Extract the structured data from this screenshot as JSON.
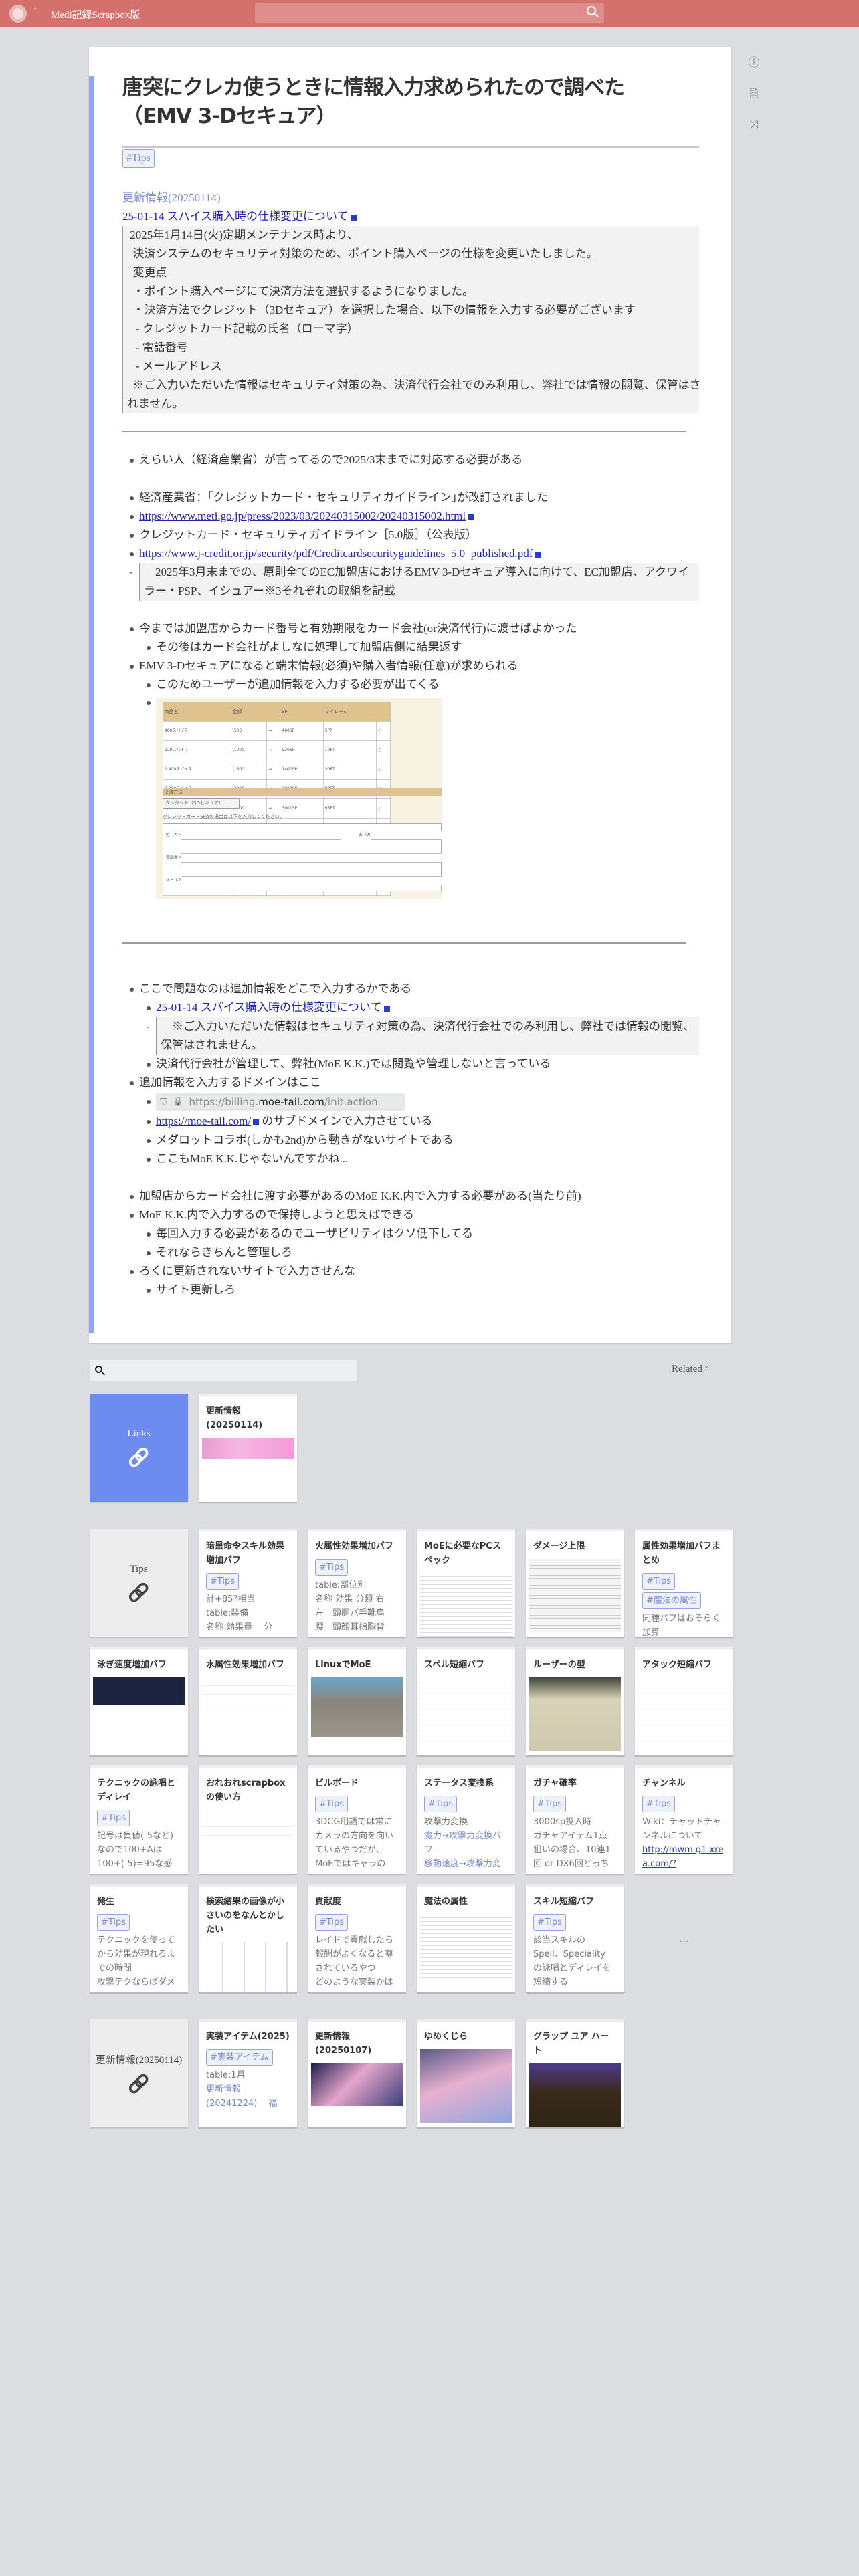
{
  "header": {
    "project": "Medi記録Scrapbox版",
    "search_placeholder": "",
    "logo_icon": "scrapbox-logo-icon"
  },
  "side_icons": [
    "info-icon",
    "page-icon",
    "shuffle-icon"
  ],
  "page": {
    "title": [
      "唐突にクレカ使うときに情報入力求められたので調べた",
      "（EMV 3-Dセキュア）"
    ],
    "tag": "#Tips",
    "update_title": "更新情報(20250114)",
    "update_link": "25-01-14 スパイス購入時の仕様変更について",
    "notice": [
      " 2025年1月14日(火)定期メンテナンス時より、",
      "  決済システムのセキュリティ対策のため、ポイント購入ページの仕様を変更いたしました。",
      "  変更点",
      "  ・ポイント購入ページにて決済方法を選択するようになりました。",
      "  ・決済方法でクレジット（3Dセキュア）を選択した場合、以下の情報を入力する必要がございます",
      "   - クレジットカード記載の氏名（ローマ字）",
      "   - 電話番号",
      "   - メールアドレス",
      "  ※ご入力いただいた情報はセキュリティ対策の為、決済代行会社でのみ利用し、弊社では情報の閲覧、保管はさ",
      "れません。"
    ],
    "items": [
      {
        "kind": "text",
        "level": 1,
        "text": "えらい人（経済産業省）が言ってるので2025/3末までに対応する必要がある"
      },
      {
        "kind": "blank"
      },
      {
        "kind": "text",
        "level": 1,
        "text": "経済産業省：｢クレジットカード・セキュリティガイドライン｣が改訂されました"
      },
      {
        "kind": "link",
        "level": 1,
        "text": "https://www.meti.go.jp/press/2023/03/20240315002/20240315002.html"
      },
      {
        "kind": "text",
        "level": 1,
        "text": "クレジットカード・セキュリティガイドライン［5.0版］（公表版）"
      },
      {
        "kind": "link",
        "level": 1,
        "text": "https://www.j-credit.or.jp/security/pdf/Creditcardsecurityguidelines_5.0_published.pdf"
      },
      {
        "kind": "quote",
        "level": 1,
        "text": "　2025年3月末までの、原則全てのEC加盟店におけるEMV 3-Dセキュア導入に向けて、EC加盟店、アクワイラー・PSP、イシュアー※3それぞれの取組を記載"
      },
      {
        "kind": "blank"
      },
      {
        "kind": "text",
        "level": 1,
        "text": "今までは加盟店からカード番号と有効期限をカード会社(or決済代行)に渡せばよかった"
      },
      {
        "kind": "text",
        "level": 2,
        "text": "その後はカード会社がよしなに処理して加盟店側に結果返す"
      },
      {
        "kind": "text",
        "level": 1,
        "text": "EMV 3-Dセキュアになると端末情報(必須)や購入者情報(任意)が求められる"
      },
      {
        "kind": "text",
        "level": 2,
        "text": "このためユーザーが追加情報を入力する必要が出てくる"
      },
      {
        "kind": "image",
        "level": 2
      },
      {
        "kind": "blank"
      },
      {
        "kind": "hr"
      },
      {
        "kind": "text",
        "level": 1,
        "text": "ここで問題なのは追加情報をどこで入力するかである"
      },
      {
        "kind": "link",
        "level": 2,
        "text": "25-01-14 スパイス購入時の仕様変更について"
      },
      {
        "kind": "quote",
        "level": 2,
        "text": "　※ご入力いただいた情報はセキュリティ対策の為、決済代行会社でのみ利用し、弊社では情報の閲覧、保管はされません。"
      },
      {
        "kind": "text",
        "level": 2,
        "text": "決済代行会社が管理して、弊社(MoE K.K.)では閲覧や管理しないと言っている"
      },
      {
        "kind": "text",
        "level": 1,
        "text": "追加情報を入力するドメインはここ"
      },
      {
        "kind": "urlbar",
        "level": 2,
        "pre": "https://billing.",
        "host": "moe-tail.com",
        "post": "/init.action"
      },
      {
        "kind": "linktext",
        "level": 2,
        "link": "https://moe-tail.com/",
        "text": " のサブドメインで入力させている"
      },
      {
        "kind": "text",
        "level": 2,
        "text": "メダロットコラボ(しかも2nd)から動きがないサイトである"
      },
      {
        "kind": "text",
        "level": 2,
        "text": "ここもMoE K.K.じゃないんですかね..."
      },
      {
        "kind": "blank"
      },
      {
        "kind": "text",
        "level": 1,
        "text": "加盟店からカード会社に渡す必要があるのMoE K.K.内で入力する必要がある(当たり前)"
      },
      {
        "kind": "text",
        "level": 1,
        "text": "MoE K.K.内で入力するので保持しようと思えばできる"
      },
      {
        "kind": "text",
        "level": 2,
        "text": "毎回入力する必要があるのでユーザビリティはクソ低下してる"
      },
      {
        "kind": "text",
        "level": 2,
        "text": "それならきちんと管理しろ"
      },
      {
        "kind": "text",
        "level": 1,
        "text": "ろくに更新されないサイトで入力させんな"
      },
      {
        "kind": "text",
        "level": 2,
        "text": "サイト更新しろ"
      }
    ],
    "screenshot": {
      "headers": [
        "商品名",
        "金額",
        "",
        "SP",
        "マイレージ"
      ],
      "rows": [
        [
          "460スパイス",
          "\\500",
          "→",
          "460SP",
          "5PT"
        ],
        [
          "920スパイス",
          "\\1000",
          "→",
          "920SP",
          "10PT"
        ],
        [
          "1,400スパイス",
          "\\1500",
          "→",
          "1400SP",
          "30PT"
        ],
        [
          "2,800スパイス",
          "\\3000",
          "→",
          "2800SP",
          "90PT"
        ],
        [
          "3,000スパイス",
          "\\3200",
          "→",
          "3000SP",
          "95PT"
        ],
        [
          "4,800スパイス",
          "\\5000",
          "→",
          "4800SP",
          "200PT"
        ],
        [
          "5,000スパイス",
          "\\5200",
          "→",
          "5000SP",
          "210PT"
        ],
        [
          "9,800スパイス",
          "\\10000",
          "→",
          "9800SP",
          "500PT"
        ],
        [
          "10,000スパイス",
          "\\10200",
          "→",
          "10000SP",
          "520PT"
        ]
      ],
      "payment_label": "決済方法",
      "payment_value": "クレジット（3Dセキュア）",
      "note": "クレジットカード決済の場合は以下を入力してください。",
      "fields": [
        "姓（カード券面ローマ字）",
        "名（カード券面ローマ字）",
        "電話番号",
        "メールアドレス"
      ]
    }
  },
  "related": {
    "search_placeholder": "",
    "sort_label": "Related",
    "more_label": "...",
    "groups": [
      {
        "header": "Links",
        "style": "blue",
        "cards": [
          {
            "title": "更新情報(20250114)",
            "thumb": "pink",
            "lines": []
          }
        ]
      },
      {
        "header": "Tips",
        "style": "gray",
        "more": true,
        "cards": [
          {
            "title": "暗黒命令スキル効果増加バフ",
            "lines": [
              {
                "t": "#Tips",
                "k": "tag"
              },
              {
                "t": "計+85?相当",
                "k": "text"
              },
              {
                "t": "table:装備",
                "k": "text"
              },
              {
                "t": "名称 効果量　 分",
                "k": "text"
              }
            ]
          },
          {
            "title": "火属性効果増加バフ",
            "lines": [
              {
                "t": "#Tips",
                "k": "tag"
              },
              {
                "t": "table:部位別",
                "k": "text"
              },
              {
                "t": "名称 効果 分類 右",
                "k": "text"
              },
              {
                "t": "左　頭胴パ手靴肩",
                "k": "text"
              },
              {
                "t": "腰　頭顔耳指胸背",
                "k": "text"
              }
            ]
          },
          {
            "title": "MoEに必要なPCスペック",
            "thumb": "doc",
            "lines": []
          },
          {
            "title": "ダメージ上限",
            "thumb": "table",
            "lines": []
          },
          {
            "title": "属性効果増加バフまとめ",
            "lines": [
              {
                "t": "#Tips",
                "k": "tag"
              },
              {
                "t": "#魔法の属性",
                "k": "tag"
              },
              {
                "t": "同種バフはおそらく",
                "k": "text"
              },
              {
                "t": "加算",
                "k": "text"
              }
            ]
          },
          {
            "title": "泳ぎ速度増加バフ",
            "thumb": "dark",
            "lines": []
          },
          {
            "title": "水属性効果増加バフ",
            "thumb": "blank",
            "lines": []
          },
          {
            "title": "LinuxでMoE",
            "thumb": "game",
            "lines": []
          },
          {
            "title": "スペル短縮バフ",
            "thumb": "doc",
            "lines": []
          },
          {
            "title": "ルーザーの型",
            "thumb": "gameui",
            "lines": []
          },
          {
            "title": "アタック短縮バフ",
            "thumb": "doc",
            "lines": []
          },
          {
            "title": "テクニックの詠唱とディレイ",
            "lines": [
              {
                "t": "#Tips",
                "k": "tag"
              },
              {
                "t": "記号は負値(-5など)",
                "k": "text"
              },
              {
                "t": "なので100+Aは",
                "k": "text"
              },
              {
                "t": "100+(-5)=95な感",
                "k": "text"
              }
            ]
          },
          {
            "title": "おれおれscrapboxの使い方",
            "thumb": "blank",
            "lines": []
          },
          {
            "title": "ビルボード",
            "lines": [
              {
                "t": "#Tips",
                "k": "tag"
              },
              {
                "t": "3DCG用語では常に",
                "k": "text"
              },
              {
                "t": "カメラの方向を向い",
                "k": "text"
              },
              {
                "t": "ているやつだが、",
                "k": "text"
              },
              {
                "t": "MoEではキャラの",
                "k": "text"
              }
            ]
          },
          {
            "title": "ステータス変換系",
            "lines": [
              {
                "t": "#Tips",
                "k": "tag"
              },
              {
                "t": "攻撃力変換",
                "k": "text"
              },
              {
                "t": "魔力→攻撃力変換バ",
                "k": "link"
              },
              {
                "t": "フ",
                "k": "link"
              },
              {
                "t": "移動速度→攻撃力変",
                "k": "link"
              }
            ]
          },
          {
            "title": "ガチャ確率",
            "lines": [
              {
                "t": "#Tips",
                "k": "tag"
              },
              {
                "t": "3000sp投入時",
                "k": "text"
              },
              {
                "t": "ガチャアイテム1点",
                "k": "text"
              },
              {
                "t": "狙いの場合、10連1",
                "k": "text"
              },
              {
                "t": "回 or DX6回どっち",
                "k": "text"
              }
            ]
          },
          {
            "title": "チャンネル",
            "lines": [
              {
                "t": "#Tips",
                "k": "tag"
              },
              {
                "t": "Wiki：チャットチャ",
                "k": "text"
              },
              {
                "t": "ンネルについて",
                "k": "text"
              },
              {
                "t": "http://mwm.g1.xrea.com/?",
                "k": "ulink"
              }
            ]
          },
          {
            "title": "発生",
            "lines": [
              {
                "t": "#Tips",
                "k": "tag"
              },
              {
                "t": "テクニックを使って",
                "k": "text"
              },
              {
                "t": "から効果が現れるま",
                "k": "text"
              },
              {
                "t": "での時間",
                "k": "text"
              },
              {
                "t": "攻撃テクならばダメ",
                "k": "text"
              }
            ]
          },
          {
            "title": "検索結果の画像が小さいのをなんとかしたい",
            "thumb": "grid",
            "lines": []
          },
          {
            "title": "貢献度",
            "lines": [
              {
                "t": "#Tips",
                "k": "tag"
              },
              {
                "t": "レイドで貢献したら",
                "k": "text"
              },
              {
                "t": "報酬がよくなると噂",
                "k": "text"
              },
              {
                "t": "されているやつ",
                "k": "text"
              },
              {
                "t": "どのような実装かは",
                "k": "text"
              }
            ]
          },
          {
            "title": "魔法の属性",
            "thumb": "doc",
            "lines": []
          },
          {
            "title": "スキル短縮バフ",
            "lines": [
              {
                "t": "#Tips",
                "k": "tag"
              },
              {
                "t": "該当スキルの",
                "k": "text"
              },
              {
                "t": "Spell、Speciality",
                "k": "text"
              },
              {
                "t": "の詠唱とディレイを",
                "k": "text"
              },
              {
                "t": "短縮する",
                "k": "text"
              }
            ]
          }
        ]
      },
      {
        "header": "更新情報(20250114)",
        "style": "gray",
        "cards": [
          {
            "title": "実装アイテム(2025)",
            "lines": [
              {
                "t": "#実装アイテム",
                "k": "tag"
              },
              {
                "t": "table:1月",
                "k": "text"
              },
              {
                "t": "更新情報",
                "k": "link"
              },
              {
                "t": "(20241224)　 福",
                "k": "link"
              }
            ]
          },
          {
            "title": "更新情報(20250107)",
            "thumb": "whale",
            "lines": []
          },
          {
            "title": "ゆめくじら",
            "thumb": "whale-tall",
            "lines": []
          },
          {
            "title": "グラップ ユア ハート",
            "thumb": "darkgame",
            "lines": []
          }
        ]
      }
    ]
  },
  "colors": {
    "header": "#d4716d",
    "accent": "#90a4f4",
    "links_card": "#6d8cef",
    "tag": "#7b8bd0",
    "link": "#2222aa",
    "background": "#dcdde0"
  }
}
